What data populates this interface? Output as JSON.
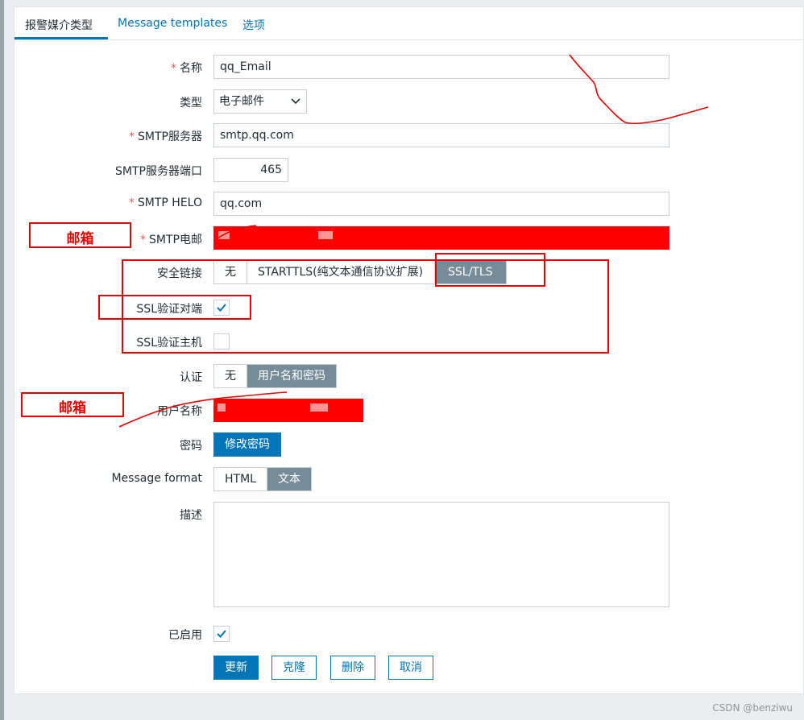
{
  "tabs": [
    {
      "label": "报警媒介类型",
      "active": true
    },
    {
      "label": "Message templates",
      "active": false
    },
    {
      "label": "选项",
      "active": false
    }
  ],
  "form": {
    "name": {
      "label": "名称",
      "value": "qq_Email",
      "required": true
    },
    "type": {
      "label": "类型",
      "value": "电子邮件"
    },
    "smtp_server": {
      "label": "SMTP服务器",
      "value": "smtp.qq.com",
      "required": true
    },
    "smtp_port": {
      "label": "SMTP服务器端口",
      "value": "465"
    },
    "smtp_helo": {
      "label": "SMTP HELO",
      "value": "qq.com",
      "required": true
    },
    "smtp_email": {
      "label": "SMTP电邮",
      "required": true
    },
    "security": {
      "label": "安全链接",
      "options": [
        "无",
        "STARTTLS(纯文本通信协议扩展)",
        "SSL/TLS"
      ],
      "selected": "SSL/TLS"
    },
    "ssl_verify_peer": {
      "label": "SSL验证对端",
      "checked": true
    },
    "ssl_verify_host": {
      "label": "SSL验证主机",
      "checked": false
    },
    "auth": {
      "label": "认证",
      "options": [
        "无",
        "用户名和密码"
      ],
      "selected": "用户名和密码"
    },
    "username": {
      "label": "用户名称"
    },
    "password": {
      "label": "密码",
      "button": "修改密码"
    },
    "message_format": {
      "label": "Message format",
      "options": [
        "HTML",
        "文本"
      ],
      "selected": "文本"
    },
    "description": {
      "label": "描述",
      "value": ""
    },
    "enabled": {
      "label": "已启用",
      "checked": true
    }
  },
  "actions": {
    "update": "更新",
    "clone": "克隆",
    "delete": "删除",
    "cancel": "取消"
  },
  "annotations": {
    "email_note_1": "邮箱",
    "email_note_2": "邮箱"
  },
  "watermark": "CSDN @benziwu",
  "colors": {
    "accent": "#0275b8",
    "selected_segment": "#768d99",
    "annotation": "#e60000",
    "required": "#e45959"
  }
}
